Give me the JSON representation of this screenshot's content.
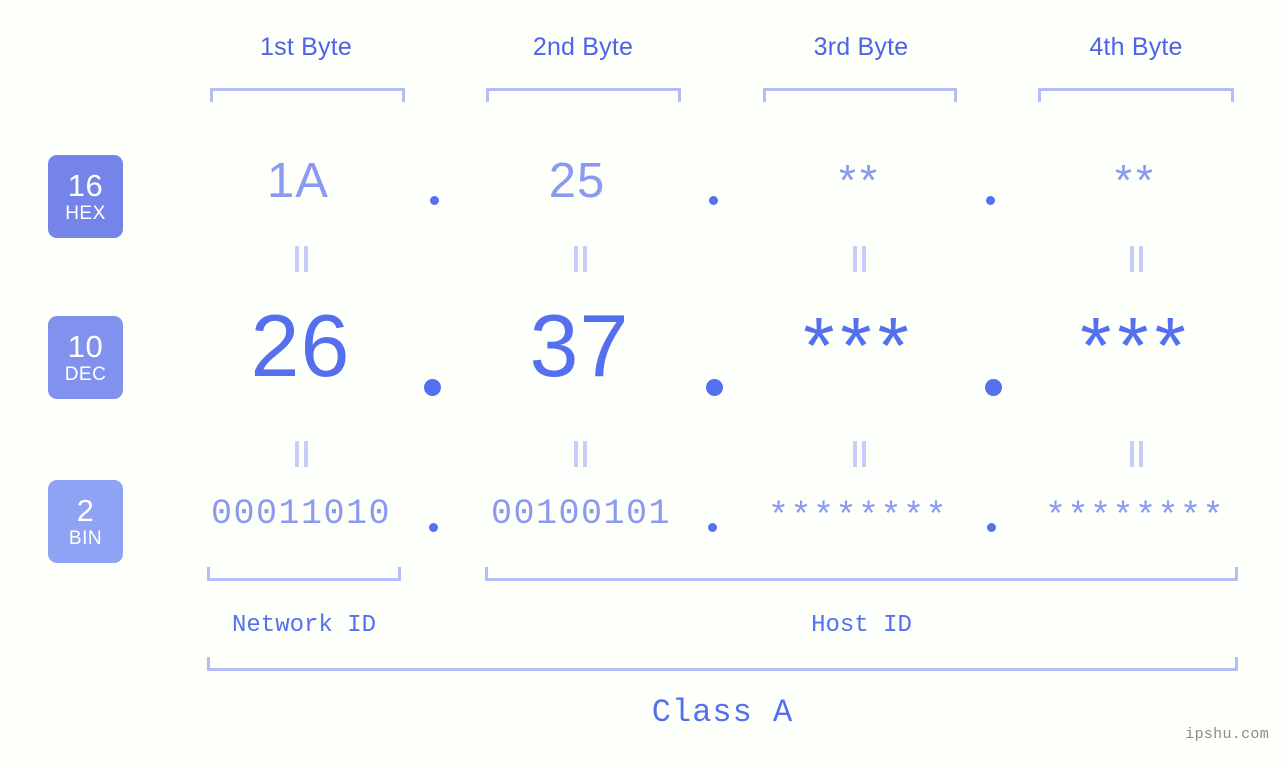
{
  "background_color": "#fdfffa",
  "accent_colors": {
    "strong_blue": "#5570ef",
    "light_blue": "#8b99f0",
    "bracket_blue": "#b4bdf5",
    "badge_hex": "#7584e8",
    "badge_dec": "#8191ee",
    "badge_bin": "#8fa3f5"
  },
  "headers": [
    {
      "label": "1st Byte"
    },
    {
      "label": "2nd Byte"
    },
    {
      "label": "3rd Byte"
    },
    {
      "label": "4th Byte"
    }
  ],
  "radix_badges": [
    {
      "number": "16",
      "abbr": "HEX"
    },
    {
      "number": "10",
      "abbr": "DEC"
    },
    {
      "number": "2",
      "abbr": "BIN"
    }
  ],
  "rows": {
    "hex": {
      "radix": "16",
      "name": "HEX",
      "values": [
        "1A",
        "25",
        "**",
        "**"
      ],
      "masked": [
        false,
        false,
        true,
        true
      ]
    },
    "dec": {
      "radix": "10",
      "name": "DEC",
      "values": [
        "26",
        "37",
        "***",
        "***"
      ],
      "masked": [
        false,
        false,
        true,
        true
      ]
    },
    "bin": {
      "radix": "2",
      "name": "BIN",
      "values": [
        "00011010",
        "00100101",
        "********",
        "********"
      ],
      "masked": [
        false,
        false,
        true,
        true
      ]
    }
  },
  "separators": {
    "dot": "."
  },
  "equality_marker": "=",
  "sections": [
    {
      "label": "Network ID"
    },
    {
      "label": "Host ID"
    }
  ],
  "class_label": "Class A",
  "watermark": "ipshu.com"
}
